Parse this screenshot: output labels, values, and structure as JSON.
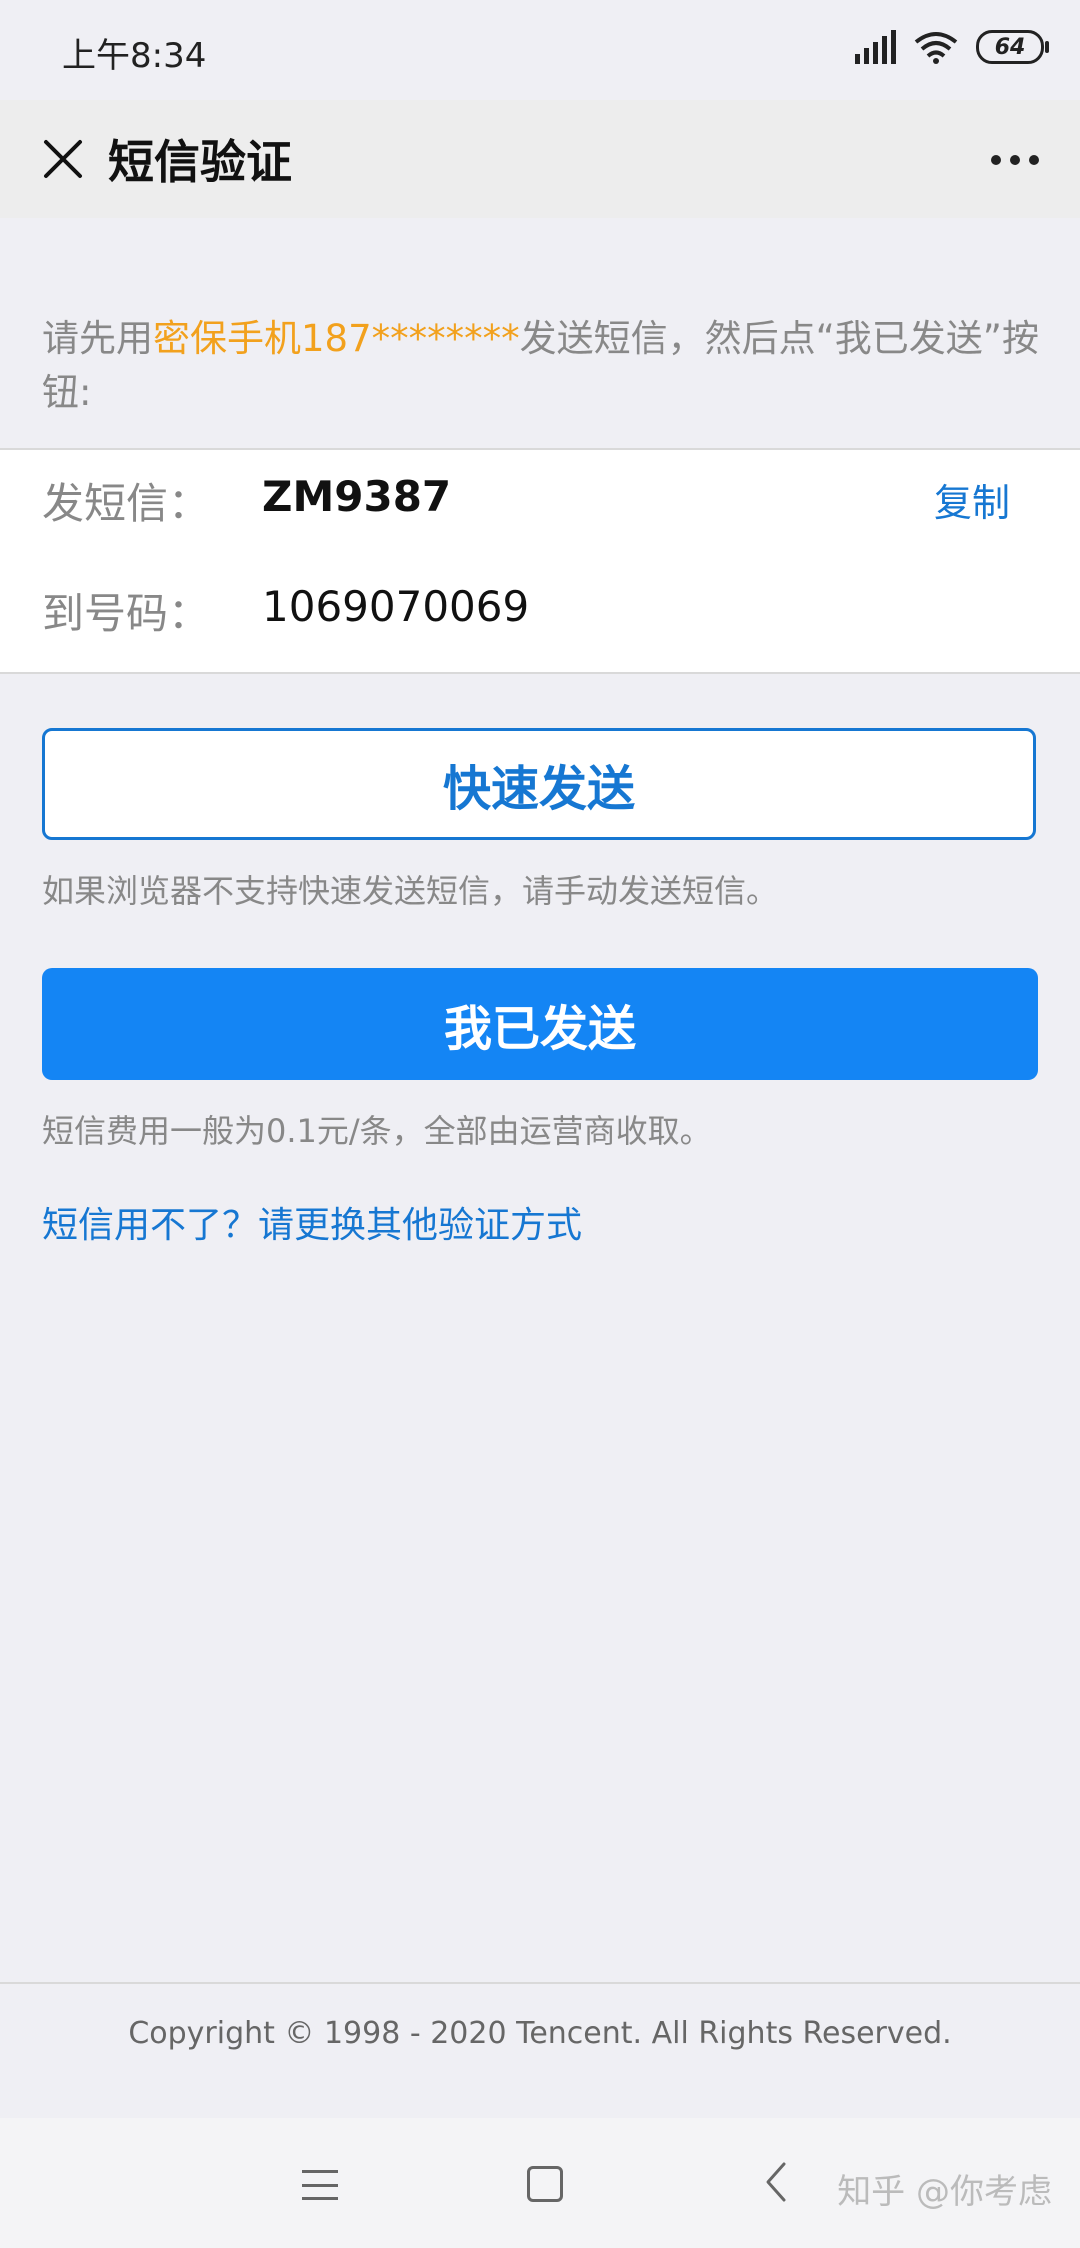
{
  "status_bar": {
    "time": "上午8:34",
    "battery": "64",
    "icons": [
      "signal-icon",
      "wifi-icon",
      "battery-icon"
    ]
  },
  "nav": {
    "title": "短信验证",
    "close_icon": "close-icon",
    "more_icon": "more-icon"
  },
  "instruction": {
    "prefix": "请先用",
    "highlight": "密保手机187********",
    "suffix": "发送短信，然后点“我已发送”按钮:",
    "highlight_color": "#f2a11d"
  },
  "sms": {
    "content_label": "发短信：",
    "content_value": "ZM9387",
    "copy_label": "复制",
    "number_label": "到号码：",
    "number_value": "1069070069"
  },
  "quick_send": {
    "label": "快速发送",
    "hint": "如果浏览器不支持快速发送短信，请手动发送短信。"
  },
  "sent_button": {
    "label": "我已发送",
    "hint": "短信费用一般为0.1元/条，全部由运营商收取。"
  },
  "alt_link": "短信用不了？请更换其他验证方式",
  "footer": {
    "copyright": "Copyright © 1998 - 2020 Tencent. All Rights Reserved."
  },
  "watermark": "知乎 @你考虑",
  "colors": {
    "accent": "#1677d2",
    "primary_button": "#1485f4",
    "highlight": "#f2a11d"
  }
}
